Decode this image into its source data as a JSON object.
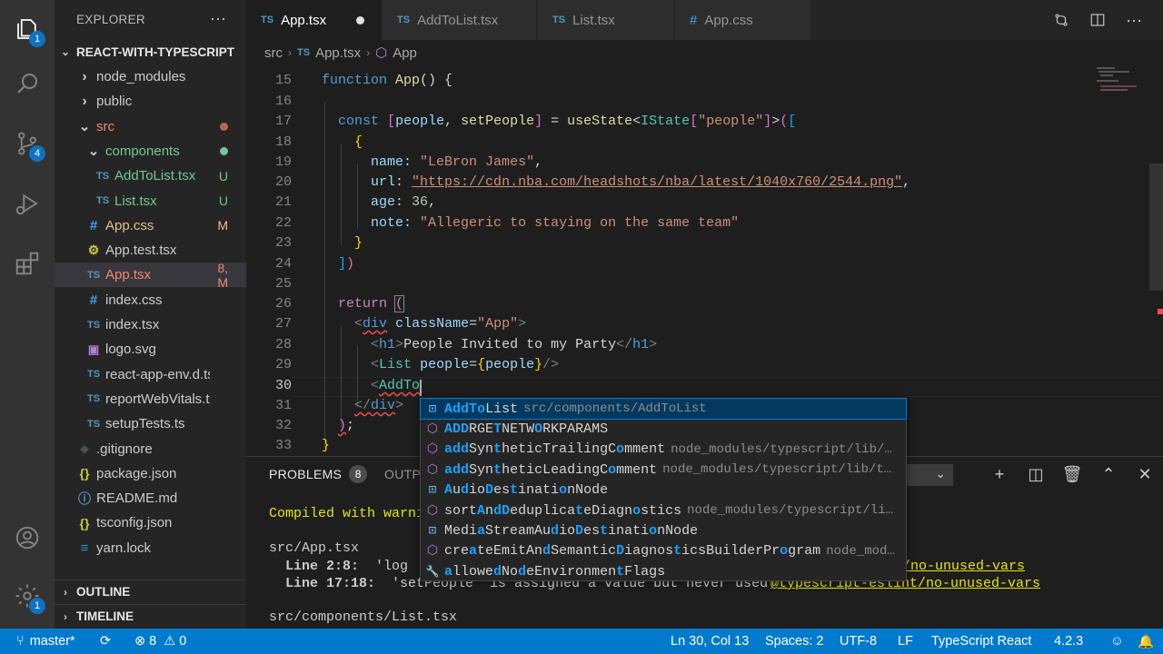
{
  "activity_bar": {
    "explorer_badge": "1",
    "scm_badge": "4",
    "settings_badge": "1"
  },
  "sidebar": {
    "title": "EXPLORER",
    "more": "···",
    "project": "REACT-WITH-TYPESCRIPT",
    "files": [
      {
        "label": "node_modules",
        "icon": "chevron-right",
        "status": ""
      },
      {
        "label": "public",
        "icon": "chevron-right",
        "status": ""
      },
      {
        "label": "src",
        "icon": "chevron-down",
        "status": "dot"
      },
      {
        "label": "components",
        "icon": "chevron-down",
        "status": "dot"
      },
      {
        "label": "AddToList.tsx",
        "icon": "TS",
        "status": "U"
      },
      {
        "label": "List.tsx",
        "icon": "TS",
        "status": "U"
      },
      {
        "label": "App.css",
        "icon": "#",
        "status": "M"
      },
      {
        "label": "App.test.tsx",
        "icon": "gear",
        "status": ""
      },
      {
        "label": "App.tsx",
        "icon": "TS",
        "status": "8, M"
      },
      {
        "label": "index.css",
        "icon": "#",
        "status": ""
      },
      {
        "label": "index.tsx",
        "icon": "TS",
        "status": ""
      },
      {
        "label": "logo.svg",
        "icon": "image",
        "status": ""
      },
      {
        "label": "react-app-env.d.ts",
        "icon": "TS",
        "status": ""
      },
      {
        "label": "reportWebVitals.ts",
        "icon": "TS",
        "status": ""
      },
      {
        "label": "setupTests.ts",
        "icon": "TS",
        "status": ""
      },
      {
        "label": ".gitignore",
        "icon": "git",
        "status": ""
      },
      {
        "label": "package.json",
        "icon": "{}",
        "status": ""
      },
      {
        "label": "README.md",
        "icon": "info",
        "status": ""
      },
      {
        "label": "tsconfig.json",
        "icon": "{}",
        "status": ""
      },
      {
        "label": "yarn.lock",
        "icon": "yarn",
        "status": ""
      }
    ],
    "outline": "OUTLINE",
    "timeline": "TIMELINE"
  },
  "tabs": [
    {
      "badge": "TS",
      "label": "App.tsx",
      "active": true
    },
    {
      "badge": "TS",
      "label": "AddToList.tsx"
    },
    {
      "badge": "TS",
      "label": "List.tsx"
    },
    {
      "badge": "#",
      "label": "App.css"
    }
  ],
  "breadcrumb": {
    "folder": "src",
    "file": "App.tsx",
    "symbol": "App"
  },
  "editor": {
    "line_numbers": [
      "15",
      "16",
      "17",
      "18",
      "19",
      "20",
      "21",
      "22",
      "23",
      "24",
      "25",
      "26",
      "27",
      "28",
      "29",
      "30",
      "31",
      "32",
      "33"
    ],
    "lines": {
      "l15": {
        "kw": "function",
        "name": "App",
        "rest": "() {"
      },
      "l17": {
        "kw": "const",
        "a": "[",
        "people": "people",
        "sep": ", ",
        "setter": "setPeople",
        "b": "] = ",
        "hook": "useState",
        "lt": "<",
        "type": "IState",
        "key": "\"people\"",
        "tail": ">(["
      },
      "l18": "{",
      "l19": {
        "key": "name",
        "val": "\"LeBron James\""
      },
      "l20": {
        "key": "url",
        "val": "\"https://cdn.nba.com/headshots/nba/latest/1040x760/2544.png\""
      },
      "l21": {
        "key": "age",
        "val": "36"
      },
      "l22": {
        "key": "note",
        "val": "\"Allegeric to staying on the same team\""
      },
      "l23": "}",
      "l24": "])",
      "l26": {
        "kw": "return",
        "paren": "("
      },
      "l27": {
        "tag": "div",
        "attr": "className",
        "val": "\"App\""
      },
      "l28": {
        "tag": "h1",
        "text": "People Invited to my Party"
      },
      "l29": {
        "tag": "List",
        "attr": "people",
        "val": "people"
      },
      "l30": {
        "typed": "AddTo"
      },
      "l31": {
        "tag": "div"
      },
      "l32": ");",
      "l33": "}"
    }
  },
  "suggest": [
    {
      "icon": "field",
      "label": "AddToList",
      "detail": "src/components/AddToList",
      "selected": true
    },
    {
      "icon": "cube",
      "label": "ADDRGETNETWORKPARAMS",
      "detail": ""
    },
    {
      "icon": "cube",
      "label": "addSyntheticTrailingComment",
      "detail": "node_modules/typescript/lib/…"
    },
    {
      "icon": "cube",
      "label": "addSyntheticLeadingComment",
      "detail": "node_modules/typescript/lib/t…"
    },
    {
      "icon": "field",
      "label": "AudioDestinationNode",
      "detail": ""
    },
    {
      "icon": "cube",
      "label": "sortAndDeduplicateDiagnostics",
      "detail": "node_modules/typescript/li…"
    },
    {
      "icon": "field",
      "label": "MediaStreamAudioDestinationNode",
      "detail": ""
    },
    {
      "icon": "cube",
      "label": "createEmitAndSemanticDiagnosticsBuilderProgram",
      "detail": "node_mod…"
    },
    {
      "icon": "wrench",
      "label": "allowedNodeEnvironmentFlags",
      "detail": ""
    }
  ],
  "panel": {
    "problems_label": "PROBLEMS",
    "problems_count": "8",
    "output_label": "OUTPUT",
    "terminal": {
      "compiled": "Compiled with warni",
      "file1": "src/App.tsx",
      "line1_loc": "  Line 2:8:",
      "line1_msg": "  'log",
      "line1_rule": "t/no-unused-vars",
      "line2_loc": "  Line 17:18:",
      "line2_msg": "  'setPeople' is assigned a value but never used",
      "line2_rule": "@typescript-eslint/no-unused-vars",
      "file2": "src/components/List.tsx"
    }
  },
  "status_bar": {
    "branch": "master*",
    "errors": "8",
    "warnings": "0",
    "position": "Ln 30, Col 13",
    "spaces": "Spaces: 2",
    "encoding": "UTF-8",
    "eol": "LF",
    "language": "TypeScript React",
    "version": "4.2.3"
  },
  "colors": {
    "accent": "#007acc",
    "modified": "#e2c08d",
    "error": "#f48771",
    "untracked": "#73c991"
  }
}
